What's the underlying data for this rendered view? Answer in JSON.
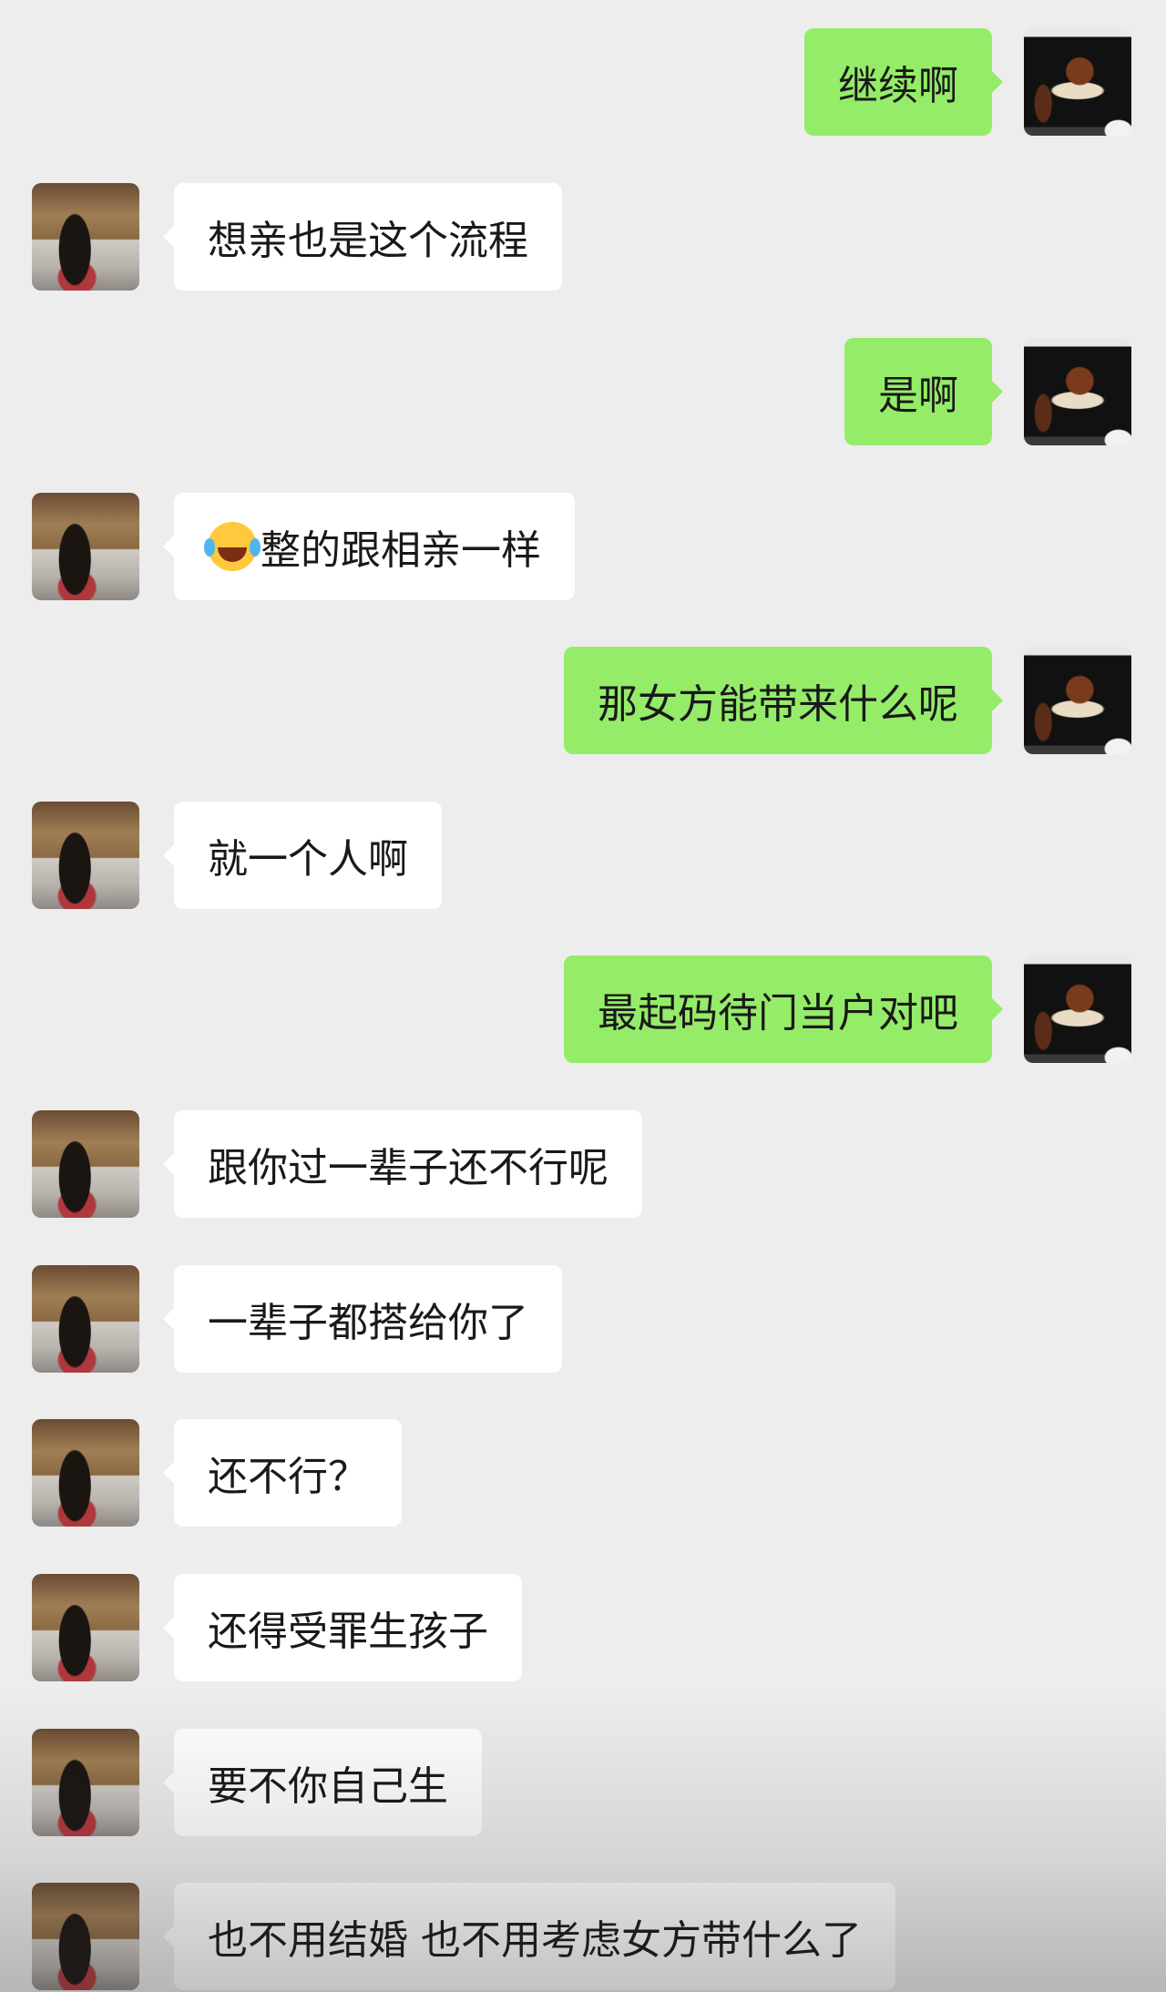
{
  "messages": [
    {
      "side": "out",
      "text": "继续啊"
    },
    {
      "side": "in",
      "text": "想亲也是这个流程"
    },
    {
      "side": "out",
      "text": "是啊"
    },
    {
      "side": "in",
      "emoji": "laughing-with-tears-emoji",
      "text": "整的跟相亲一样"
    },
    {
      "side": "out",
      "text": "那女方能带来什么呢"
    },
    {
      "side": "in",
      "text": "就一个人啊"
    },
    {
      "side": "out",
      "text": "最起码待门当户对吧"
    },
    {
      "side": "in",
      "text": "跟你过一辈子还不行呢"
    },
    {
      "side": "in",
      "text": "一辈子都搭给你了"
    },
    {
      "side": "in",
      "text": "还不行？"
    },
    {
      "side": "in",
      "text": "还得受罪生孩子"
    },
    {
      "side": "in",
      "text": "要不你自己生"
    },
    {
      "side": "in",
      "text": "也不用结婚 也不用考虑女方带什么了"
    }
  ],
  "colors": {
    "background": "#EDEDED",
    "outgoing_bubble": "#95EC69",
    "incoming_bubble": "#FFFFFF",
    "text": "#191919"
  }
}
